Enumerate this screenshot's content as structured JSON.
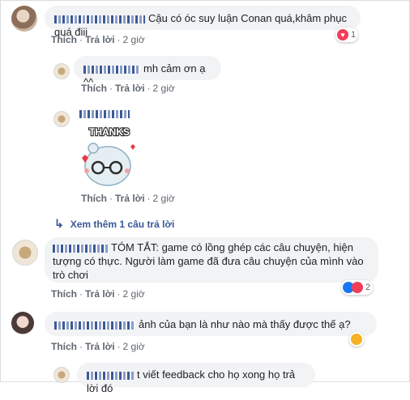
{
  "comments": [
    {
      "text": "Cậu có óc suy luận Conan quá,khâm phục quá điii",
      "like": "Thích",
      "reply": "Trả lời",
      "time": "2 giờ",
      "reaction_count": "1"
    },
    {
      "text": "mh cảm ơn ạ ^^",
      "like": "Thích",
      "reply": "Trả lời",
      "time": "2 giờ"
    },
    {
      "sticker_text": "THANKS",
      "like": "Thích",
      "reply": "Trả lời",
      "time": "2 giờ"
    },
    {
      "text": "TÓM TẮT: game có lồng ghép các câu chuyện, hiện tượng có thực. Người làm game đã đưa câu chuyện của mình vào trò chơi",
      "like": "Thích",
      "reply": "Trả lời",
      "time": "2 giờ",
      "reaction_count": "2"
    },
    {
      "text": "ảnh của bạn là như nào mà thấy được thế ạ?",
      "like": "Thích",
      "reply": "Trả lời",
      "time": "2 giờ"
    },
    {
      "text": "t viết feedback cho họ xong họ trả lời đó"
    }
  ],
  "see_more": "Xem thêm 1 câu trả lời",
  "colors": {
    "like_blue": "#1877f2",
    "heart_red": "#f33e58",
    "wow_yellow": "#f7b125",
    "link_blue": "#385898"
  }
}
